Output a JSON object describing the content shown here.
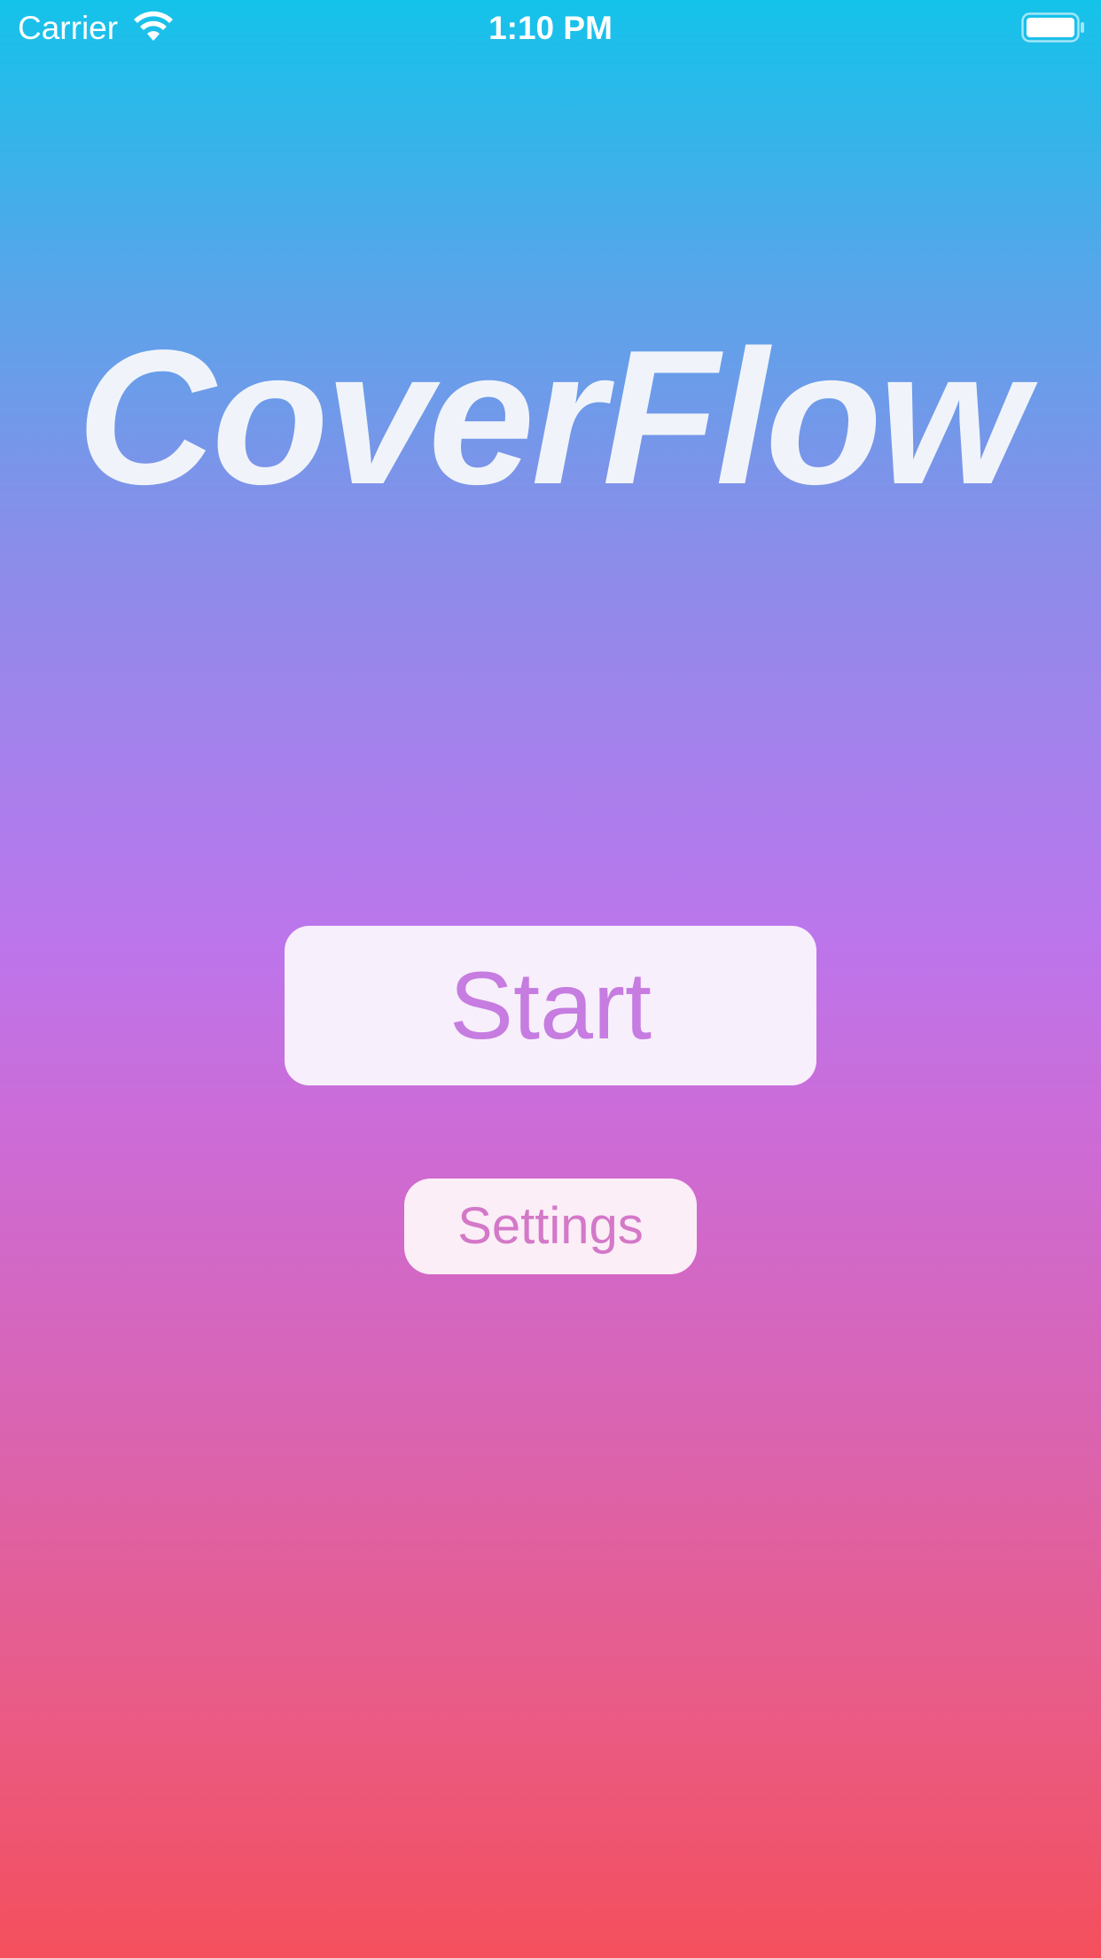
{
  "status_bar": {
    "carrier": "Carrier",
    "time": "1:10 PM",
    "wifi_icon": "wifi-icon",
    "battery_icon": "battery-icon",
    "battery_level": 1.0
  },
  "main": {
    "title": "CoverFlow",
    "start_label": "Start",
    "settings_label": "Settings"
  },
  "colors": {
    "gradient_top": "#14c3ea",
    "gradient_mid": "#bc75eb",
    "gradient_bottom": "#f44f5c",
    "title_color": "#f0f4fa",
    "start_text": "#c67ce0",
    "settings_text": "#d478c8",
    "button_bg": "#f7effb"
  }
}
